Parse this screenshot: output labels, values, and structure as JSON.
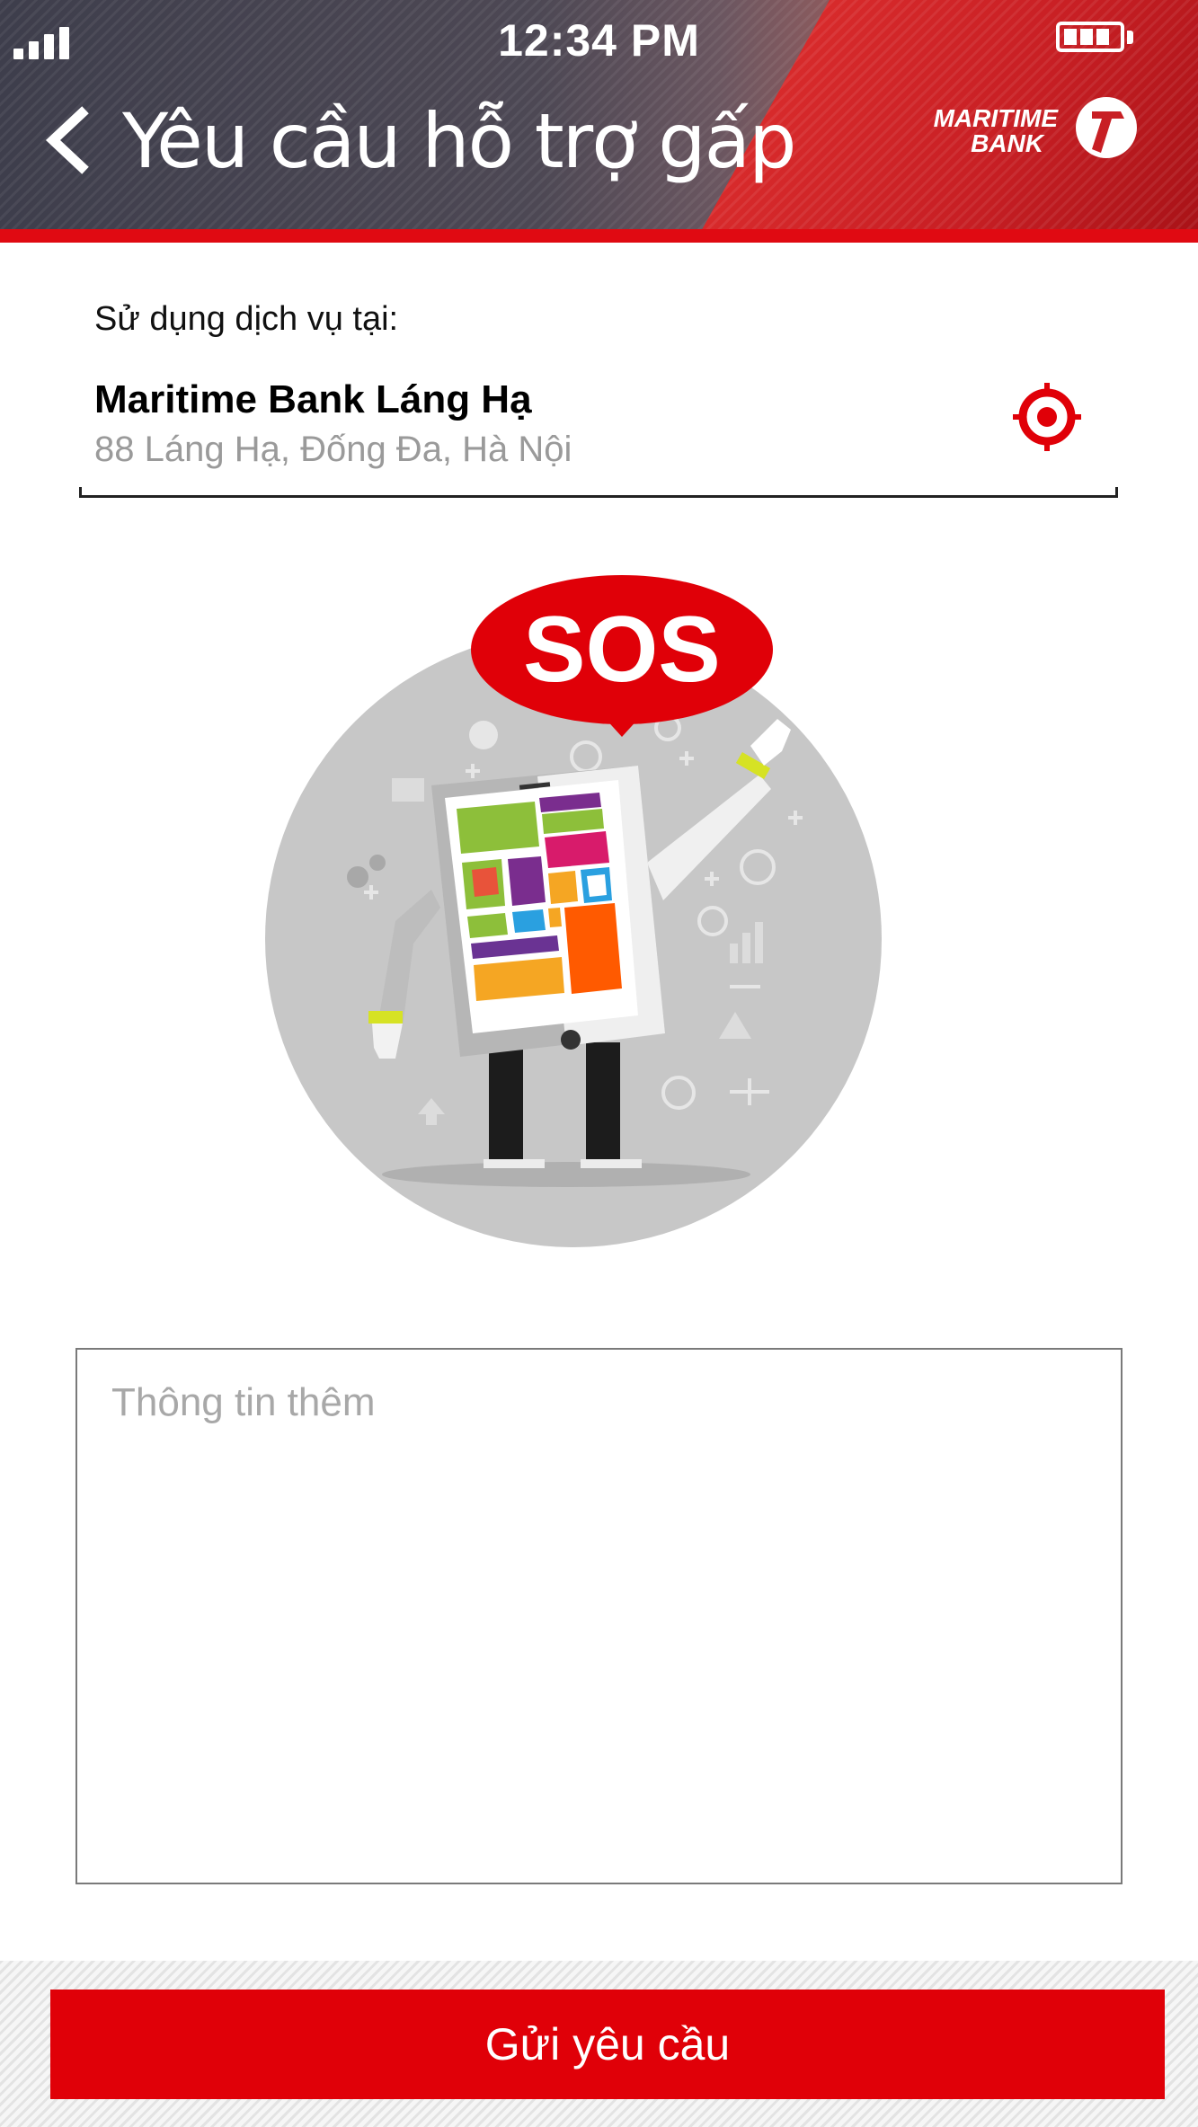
{
  "status_bar": {
    "time": "12:34 PM",
    "signal_icon": "signal-bars-icon",
    "battery_icon": "battery-icon"
  },
  "header": {
    "back_icon": "chevron-left-icon",
    "title": "Yêu cầu hỗ trợ gấp",
    "logo_line1": "MARITIME",
    "logo_line2": "BANK"
  },
  "location": {
    "label": "Sử dụng dịch vụ tại:",
    "branch_name": "Maritime Bank Láng Hạ",
    "address": "88 Láng Hạ, Đống Đa, Hà Nội",
    "locate_icon": "target-icon"
  },
  "illustration": {
    "bubble_text": "SOS"
  },
  "info_field": {
    "placeholder": "Thông tin thêm",
    "value": ""
  },
  "footer": {
    "submit_label": "Gửi yêu cầu"
  },
  "colors": {
    "brand_red": "#e00008",
    "header_dark": "#3e3e4c",
    "circle_gray": "#c7c7c7"
  }
}
